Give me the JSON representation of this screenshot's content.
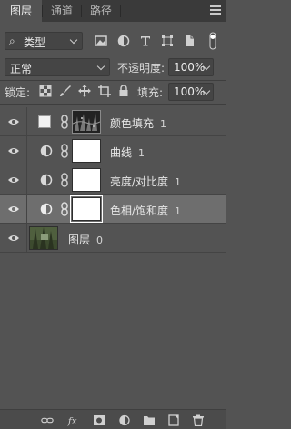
{
  "tabs": [
    {
      "label": "图层",
      "active": true
    },
    {
      "label": "通道",
      "active": false
    },
    {
      "label": "路径",
      "active": false
    }
  ],
  "filter": {
    "label": "类型",
    "icons": [
      "image-filter-icon",
      "adjustment-filter-icon",
      "type-filter-icon",
      "shape-filter-icon",
      "smart-object-filter-icon",
      "filter-toggle-icon"
    ]
  },
  "blend": {
    "mode": "正常",
    "opacity_label": "不透明度:",
    "opacity_value": "100%"
  },
  "lock": {
    "label": "锁定:",
    "icons": [
      "lock-transparent-icon",
      "lock-pixels-icon",
      "lock-position-icon",
      "lock-artboard-icon",
      "lock-all-icon"
    ],
    "fill_label": "填充:",
    "fill_value": "100%"
  },
  "layers": [
    {
      "name": "颜色填充",
      "num": "1",
      "type": "solid-fill",
      "mask": "dark",
      "visible": true,
      "selected": false
    },
    {
      "name": "曲线",
      "num": "1",
      "type": "adjustment",
      "mask": "white",
      "visible": true,
      "selected": false
    },
    {
      "name": "亮度/对比度",
      "num": "1",
      "type": "adjustment",
      "mask": "white",
      "visible": true,
      "selected": false
    },
    {
      "name": "色相/饱和度",
      "num": "1",
      "type": "adjustment",
      "mask": "white",
      "visible": true,
      "selected": true
    },
    {
      "name": "图层",
      "num": "0",
      "type": "pixel",
      "visible": true,
      "selected": false
    }
  ],
  "bottom_icons": [
    "link-layers-icon",
    "fx-icon",
    "add-mask-icon",
    "new-adjustment-icon",
    "new-group-icon",
    "new-layer-icon",
    "delete-layer-icon"
  ],
  "colors": {
    "panel": "#535353",
    "tabbar": "#3a3a3a",
    "selected_row": "#6e6e6e",
    "field": "#454545"
  }
}
